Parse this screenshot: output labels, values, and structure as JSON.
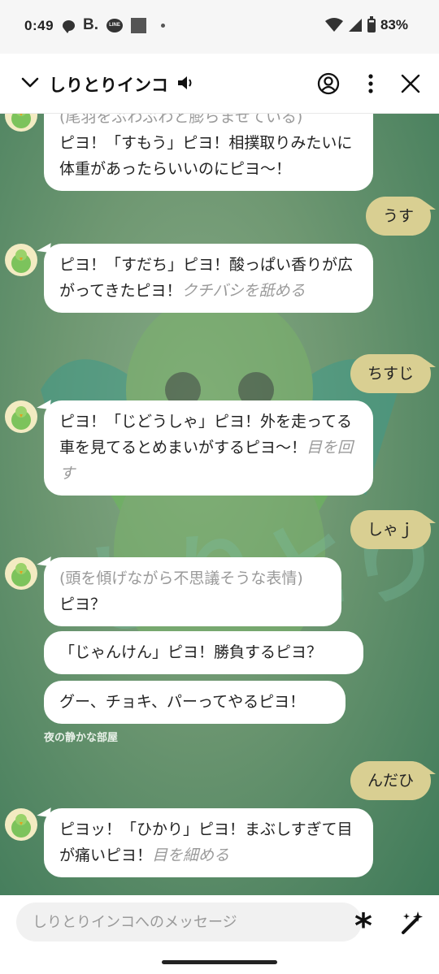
{
  "status_bar": {
    "time": "0:49",
    "line_icon_text": "LINE",
    "b_icon_text": "B.",
    "battery": "83%"
  },
  "header": {
    "title": "しりとりインコ"
  },
  "messages": [
    {
      "id": "m0",
      "text_meta": "(尾羽をぶわぶわと膨らませている)",
      "text": "ピヨ！「すもう」ピヨ！相撲取りみたいに体重があったらいいのにピヨ〜！"
    },
    {
      "id": "u1",
      "text": "うす"
    },
    {
      "id": "m1",
      "text": "ピヨ！「すだち」ピヨ！酸っぱい香りが広がってきたピヨ！",
      "action": "クチバシを舐める"
    },
    {
      "id": "u2",
      "text": "ちすじ"
    },
    {
      "id": "m2",
      "text": "ピヨ！「じどうしゃ」ピヨ！外を走ってる車を見てるとめまいがするピヨ〜！",
      "action": "目を回す"
    },
    {
      "id": "u3",
      "text": "しゃｊ"
    },
    {
      "id": "m3",
      "text_meta": "(頭を傾げながら不思議そうな表情)",
      "text": "ピヨ？"
    },
    {
      "id": "m4",
      "text": "「じゃんけん」ピヨ！勝負するピヨ？"
    },
    {
      "id": "m5",
      "text": "グー、チョキ、パーってやるピヨ！"
    },
    {
      "id": "u4",
      "text": "んだひ"
    },
    {
      "id": "m6",
      "text": "ピヨッ！「ひかり」ピヨ！まぶしすぎて目が痛いピヨ！",
      "action": "目を細める"
    }
  ],
  "room_label": "夜の静かな部屋",
  "composer": {
    "placeholder": "しりとりインコへのメッセージ",
    "asterisk": "*"
  },
  "colors": {
    "chat_bg": "#6f9872",
    "user_bubble": "#d9cf92",
    "bot_bubble": "#ffffff"
  }
}
